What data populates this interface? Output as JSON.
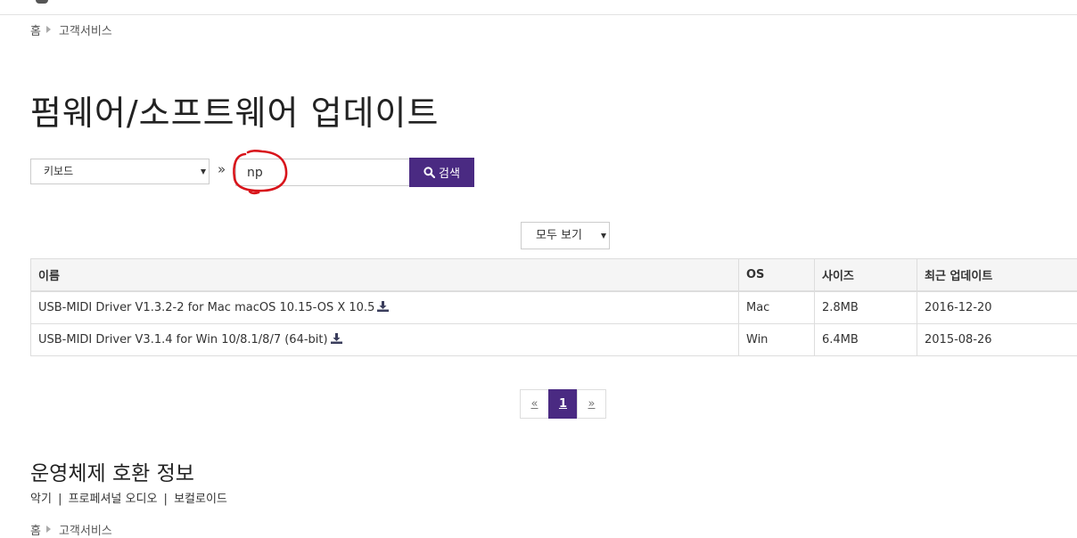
{
  "breadcrumb": {
    "home": "홈",
    "current": "고객서비스"
  },
  "page_title": "펌웨어/소프트웨어 업데이트",
  "search": {
    "category_value": "키보드",
    "separator": "»",
    "query_value": "np",
    "button_label": "검색"
  },
  "filter": {
    "selected": "모두 보기"
  },
  "table": {
    "headers": [
      "이름",
      "OS",
      "사이즈",
      "최근 업데이트"
    ],
    "rows": [
      {
        "name": "USB-MIDI Driver V1.3.2-2 for Mac macOS 10.15-OS X 10.5",
        "os": "Mac",
        "size": "2.8MB",
        "updated": "2016-12-20"
      },
      {
        "name": "USB-MIDI Driver V3.1.4 for Win 10/8.1/8/7 (64-bit)",
        "os": "Win",
        "size": "6.4MB",
        "updated": "2015-08-26"
      }
    ]
  },
  "pagination": {
    "prev": "«",
    "current": "1",
    "next": "»"
  },
  "os_section": {
    "title": "운영체제 호환 정보",
    "links": [
      "악기",
      "프로페셔널 오디오",
      "보컬로이드"
    ],
    "divider": "|"
  },
  "colors": {
    "accent": "#4a2a82",
    "annotation": "#d8141b"
  }
}
